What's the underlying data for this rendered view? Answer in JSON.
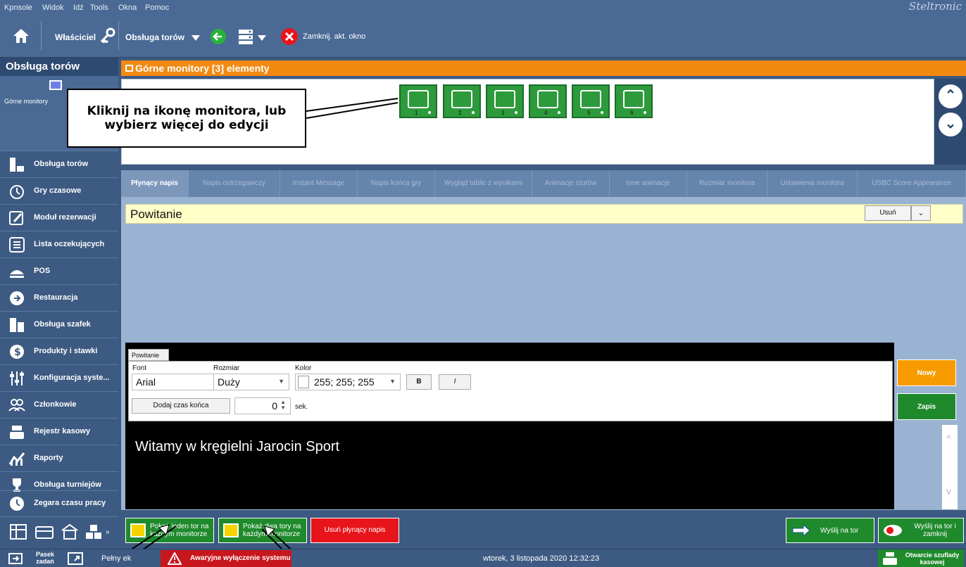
{
  "menu": {
    "items": [
      "Kpnsole",
      "Widok",
      "Idź",
      "Tools",
      "Okna",
      "Pomoc"
    ],
    "brand": "Steltronic"
  },
  "toolbar": {
    "owner_label": "Właściciel",
    "lane_service_label": "Obsługa torów",
    "close_label": "Zamknij. akt. okno"
  },
  "sidebar": {
    "title": "Obsługa torów",
    "monitors_label": "Górne monitory",
    "items": [
      {
        "label": "Obsługa torów",
        "icon": "lanes-icon"
      },
      {
        "label": "Gry czasowe",
        "icon": "timer-icon"
      },
      {
        "label": "Moduł rezerwacji",
        "icon": "reservation-icon"
      },
      {
        "label": "Lista oczekujących",
        "icon": "waiting-list-icon"
      },
      {
        "label": "POS",
        "icon": "pos-icon"
      },
      {
        "label": "Restauracja",
        "icon": "restaurant-icon"
      },
      {
        "label": "Obsługa szafek",
        "icon": "lockers-icon"
      },
      {
        "label": "Produkty i stawki",
        "icon": "dollar-icon"
      },
      {
        "label": "Konfiguracja syste...",
        "icon": "config-icon"
      },
      {
        "label": "Członkowie",
        "icon": "members-icon"
      },
      {
        "label": "Rejestr kasowy",
        "icon": "cash-register-icon"
      },
      {
        "label": "Raporty",
        "icon": "reports-icon"
      },
      {
        "label": "Obsługa turniejów",
        "icon": "trophy-icon"
      },
      {
        "label": "Zegara czasu pracy",
        "icon": "clock-icon"
      }
    ]
  },
  "main": {
    "header": "Górne monitory [3] elementy",
    "monitors": [
      "1",
      "2",
      "3",
      "4",
      "5",
      "6"
    ],
    "callout": "Kliknij na ikonę monitora, lub wybierz więcej do edycji",
    "tabs": [
      "Płynący napis",
      "Napis ostrzegawczy",
      "Instant Message",
      "Napis końca gry",
      "Wygląd tablic z wynikami",
      "Animacje rzutów",
      "Inne animacje",
      "Rozmiar monitora",
      "Ustawienia monitora",
      "USBC Score Appearance"
    ],
    "selected_message": "Powitanie",
    "delete_select": "Usuń"
  },
  "editor": {
    "tab": "Powitanie",
    "font_label": "Font",
    "font_value": "Arial",
    "size_label": "Rozmiar",
    "size_value": "Duży",
    "color_label": "Kolor",
    "color_value": "255; 255; 255",
    "bold": "B",
    "italic": "I",
    "add_end_time": "Dodaj czas końca",
    "seconds_value": "0",
    "seconds_unit": "sek.",
    "preview_text": "Witamy w kręgielni Jarocin Sport",
    "new_button": "Nowy",
    "save_button": "Zapis"
  },
  "actions": {
    "show_one": "Pokaż jeden tor na każdym monitorze",
    "show_two": "Pokaż dwa tory na każdym monitorze",
    "delete_marquee": "Usuń płynący napis",
    "send_to_lane": "Wyślij na tor",
    "send_and_close": "Wyślij na tor i zamknij"
  },
  "status": {
    "taskbar": "Pasek zadań",
    "fullscreen": "Pełny ek",
    "emergency": "Awaryjne wyłączenie systemu",
    "datetime": "wtorek, 3 listopada 2020 12:32:23",
    "drawer": "Otwarcie szuflady kasowej"
  },
  "colors": {
    "accent_orange": "#f28a12",
    "monitor_green": "#2d9a3c",
    "alert_red": "#e8141c"
  }
}
